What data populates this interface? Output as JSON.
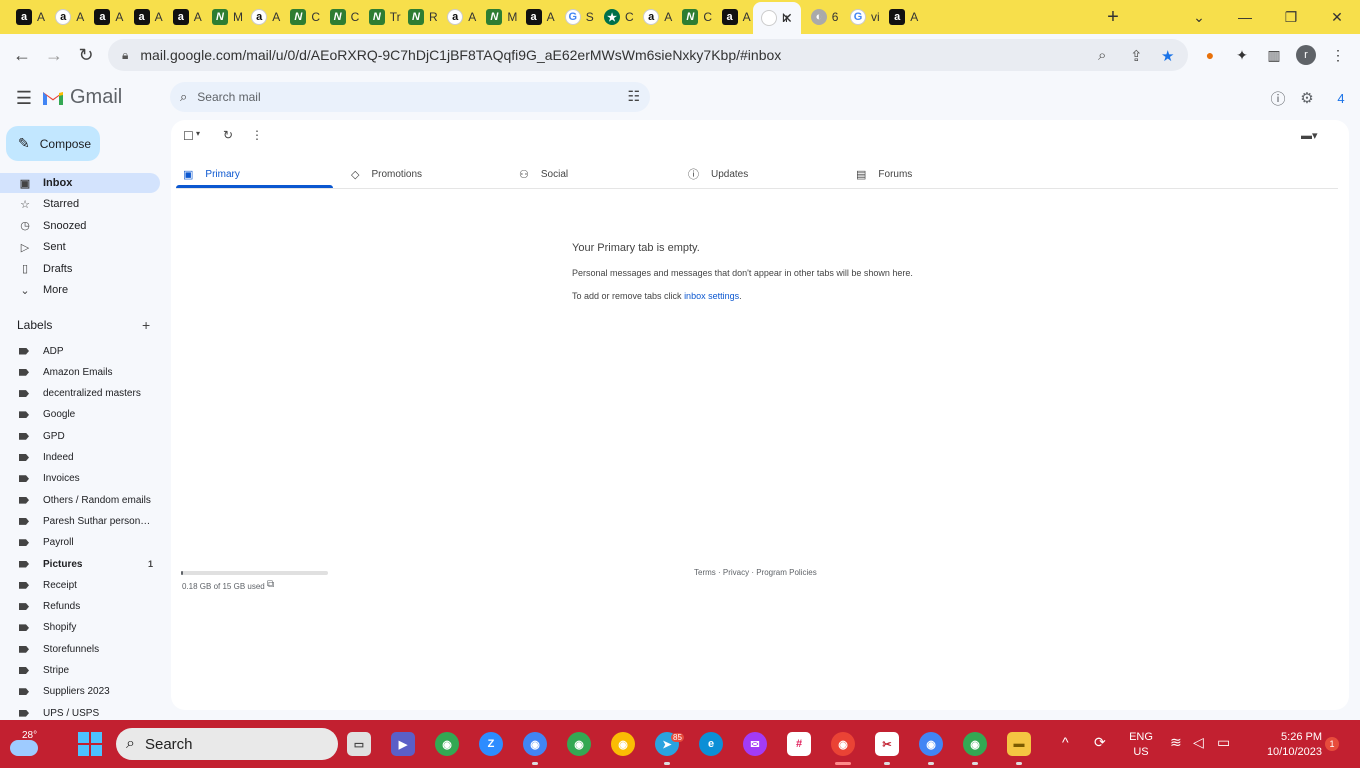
{
  "browser": {
    "tabs": [
      {
        "icon": "amazon-icon",
        "glyph": "a",
        "text": "A"
      },
      {
        "icon": "amazon-icon",
        "glyph": "a",
        "text": "A"
      },
      {
        "icon": "amazon-icon",
        "glyph": "a",
        "text": "A"
      },
      {
        "icon": "amazon-icon",
        "glyph": "a",
        "text": "A"
      },
      {
        "icon": "amazon-icon",
        "glyph": "a",
        "text": "A"
      },
      {
        "icon": "n-logo-icon",
        "glyph": "N",
        "text": "M"
      },
      {
        "icon": "amazon-icon",
        "glyph": "a",
        "text": "A"
      },
      {
        "icon": "n-logo-icon",
        "glyph": "N",
        "text": "C"
      },
      {
        "icon": "n-logo-icon",
        "glyph": "N",
        "text": "C"
      },
      {
        "icon": "n-logo-icon",
        "glyph": "N",
        "text": "Tr"
      },
      {
        "icon": "n-logo-icon",
        "glyph": "N",
        "text": "R"
      },
      {
        "icon": "amazon-icon",
        "glyph": "a",
        "text": "A"
      },
      {
        "icon": "n-logo-icon",
        "glyph": "N",
        "text": "M"
      },
      {
        "icon": "amazon-icon",
        "glyph": "a",
        "text": "A"
      },
      {
        "icon": "google-icon",
        "glyph": "G",
        "text": "S"
      },
      {
        "icon": "starbucks-icon",
        "glyph": "★",
        "text": "C"
      },
      {
        "icon": "amazon-icon",
        "glyph": "a",
        "text": "A"
      },
      {
        "icon": "n-logo-icon",
        "glyph": "N",
        "text": "C"
      },
      {
        "icon": "amazon-icon",
        "glyph": "a",
        "text": "A"
      },
      {
        "icon": "gmail-icon",
        "glyph": "",
        "text": "Ir",
        "active": true
      },
      {
        "icon": "globe-icon",
        "glyph": "◐",
        "text": "6"
      },
      {
        "icon": "google-icon",
        "glyph": "G",
        "text": "vi"
      },
      {
        "icon": "amazon-icon",
        "glyph": "a",
        "text": "A"
      }
    ],
    "new_tab": "+",
    "url": "mail.google.com/mail/u/0/d/AEoRXRQ-9C7hDjC1jBF8TAQqfi9G_aE62erMWsWm6sieNxky7Kbp/#inbox",
    "profile_initial": "r"
  },
  "gmail": {
    "brand": "Gmail",
    "search_placeholder": "Search mail",
    "account_badge": "4",
    "compose_label": "Compose",
    "nav": [
      {
        "label": "Inbox",
        "icon": "inbox-icon",
        "glyph": "▣",
        "active": true
      },
      {
        "label": "Starred",
        "icon": "star-icon",
        "glyph": "☆"
      },
      {
        "label": "Snoozed",
        "icon": "clock-icon",
        "glyph": "◷"
      },
      {
        "label": "Sent",
        "icon": "send-icon",
        "glyph": "▷"
      },
      {
        "label": "Drafts",
        "icon": "draft-icon",
        "glyph": "▯"
      },
      {
        "label": "More",
        "icon": "chevron-down-icon",
        "glyph": "⌄"
      }
    ],
    "labels_heading": "Labels",
    "labels": [
      {
        "name": "ADP"
      },
      {
        "name": "Amazon Emails"
      },
      {
        "name": "decentralized masters"
      },
      {
        "name": "Google"
      },
      {
        "name": "GPD"
      },
      {
        "name": "Indeed"
      },
      {
        "name": "Invoices"
      },
      {
        "name": "Others / Random emails"
      },
      {
        "name": "Paresh Suthar personal ..."
      },
      {
        "name": "Payroll"
      },
      {
        "name": "Pictures",
        "bold": true,
        "count": "1"
      },
      {
        "name": "Receipt"
      },
      {
        "name": "Refunds"
      },
      {
        "name": "Shopify"
      },
      {
        "name": "Storefunnels"
      },
      {
        "name": "Stripe"
      },
      {
        "name": "Suppliers 2023"
      },
      {
        "name": "UPS / USPS"
      }
    ],
    "tabs": [
      {
        "label": "Primary",
        "icon": "inbox-icon",
        "glyph": "▣",
        "active": true
      },
      {
        "label": "Promotions",
        "icon": "tag-icon",
        "glyph": "◇"
      },
      {
        "label": "Social",
        "icon": "people-icon",
        "glyph": "⚇"
      },
      {
        "label": "Updates",
        "icon": "info-icon",
        "glyph": "ⓘ"
      },
      {
        "label": "Forums",
        "icon": "forum-icon",
        "glyph": "▤"
      }
    ],
    "empty": {
      "title": "Your Primary tab is empty.",
      "description": "Personal messages and messages that don't appear in other tabs will be shown here.",
      "settings_prefix": "To add or remove tabs click ",
      "settings_link": "inbox settings",
      "settings_suffix": "."
    },
    "storage": {
      "text": "0.18 GB of 15 GB used",
      "fraction": 0.012
    },
    "footer": {
      "terms": "Terms",
      "privacy": "Privacy",
      "policies": "Program Policies",
      "sep": " · "
    }
  },
  "taskbar": {
    "temperature": "28°",
    "search_label": "Search",
    "lang_line1": "ENG",
    "lang_line2": "US",
    "time": "5:26 PM",
    "date": "10/10/2023",
    "notification_count": "1",
    "telegram_badge": "85"
  }
}
